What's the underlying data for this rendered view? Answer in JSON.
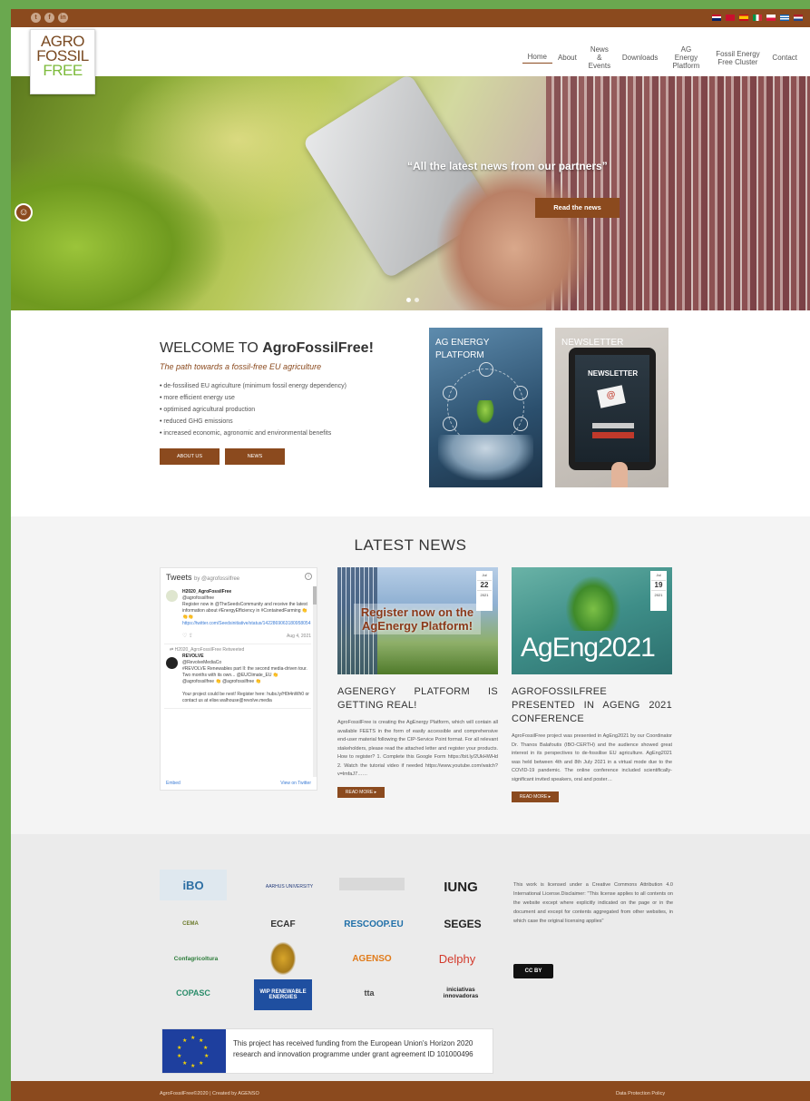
{
  "colors": {
    "brand_brown": "#8b4a1e",
    "brand_green": "#7dbb3b",
    "frame_green": "#6aa84f"
  },
  "logo": {
    "line1": "AGRO",
    "line2": "FOSSIL",
    "line3": "FREE"
  },
  "nav": {
    "home": "Home",
    "about": "About",
    "news_events": "News & Events",
    "downloads": "Downloads",
    "ag_energy_platform": "AG Energy Platform",
    "fossil_energy_free_cluster": "Fossil Energy Free Cluster",
    "contact": "Contact"
  },
  "hero": {
    "caption": "“All the latest news from our partners”",
    "button": "Read the news"
  },
  "welcome": {
    "title_prefix": "WELCOME TO ",
    "title_brand": "AgroFossilFree!",
    "tagline": "The path towards a fossil-free EU agriculture",
    "bullets": [
      "de-fossilised EU agriculture (minimum fossil energy dependency)",
      "more efficient energy use",
      "optimised agricultural production",
      "reduced GHG emissions",
      "increased economic, agronomic and environmental benefits"
    ],
    "btn_about": "ABOUT US",
    "btn_news": "NEWS"
  },
  "cards": {
    "ag_energy": "AG ENERGY PLATFORM",
    "newsletter": "NEWSLETTER",
    "newsletter_screen": "NEWSLETTER",
    "subscribe": "SUBSCRIBE"
  },
  "latest_news": {
    "heading": "LATEST NEWS",
    "tweets": {
      "title": "Tweets",
      "by": "by @agrofossilfree",
      "tweet1_name": "H2020_AgroFossilFree",
      "tweet1_handle": "@agrofossilfree",
      "tweet1_text": "Register now in @TheSeedsCommunity and receive the latest information about #EnergyEfficiency in #ContainedFarming 👏👏👏",
      "tweet1_link": "https://twitter.com/Seedsinitiative/status/1422869063180958054",
      "tweet1_date": "Aug 4, 2021",
      "retweet_label": "H2020_AgroFossilFree Retweeted",
      "tweet2_name": "REVOLVE",
      "tweet2_handle": "@RevolveMediaCo",
      "tweet2_text": "#REVOLVE Renewables part II: the second media-driven tour. Two months with its own... @EUClimate_EU 👏 @agrofossilfree 👏 @agrofossilfree 👏",
      "tweet2_more": "Your project could be next! Register here: hubs.ly/H0t4nWh0 or contact us at elise.walhouse@revolve.media",
      "embed": "Embed",
      "view_on": "View on Twitter"
    },
    "posts": [
      {
        "month": "Jul",
        "day": "22",
        "year": "2021",
        "image_text": "Register now on the AgEnergy Platform!",
        "title": "AGENERGY PLATFORM IS GETTING REAL!",
        "excerpt": "AgroFossilFree is creating the AgEnergy Platform, which will contain all available FEETS in the form of easily accessible and comprehensive end-user material following the CIP-Service Point format. For all relevant stakeholders, please read the attached letter and register your products. How to register? 1. Complete this Google Form https://bit.ly/2UkHWHd 2. Watch the tutorial video if needed https://www.youtube.com/watch?v=lmfaJ7……",
        "read_more": "READ MORE ▸"
      },
      {
        "month": "Jul",
        "day": "19",
        "year": "2021",
        "image_text": "AgEng2021",
        "title": "AGROFOSSILFREE PRESENTED IN AGENG 2021 CONFERENCE",
        "excerpt": "AgroFossilFree project was presented in AgEng2021 by our Coordinator Dr. Thanos Balafoutis (IBO-CERTH) and the audience showed great interest in its perspectives to de-fossilise EU agriculture. AgEng2021 was held between 4th and 8th July 2021 in a virtual mode due to the COVID-19 pandemic. The online conference included scientifically-significant invited speakers, oral and poster…",
        "read_more": "READ MORE ▸"
      }
    ]
  },
  "partners": {
    "logos": [
      "iBO",
      "AARHUS UNIVERSITY",
      "",
      "IUNG",
      "CEMA",
      "ECAF",
      "RESCOOP.EU",
      "SEGES",
      "Confagricoltura",
      "",
      "AGENSO",
      "Delphy",
      "COPASC",
      "WIP RENEWABLE ENERGIES",
      "tta",
      "iniciativas innovadoras"
    ],
    "license": "This work is licensed under a Creative Commons Attribution 4.0 International License.Disclaimer: \"This license applies to all contents on the website except where explicitly indicated on the page or in the document and except for contents aggregated from other websites, in which case the original licensing applies\"",
    "cc_badge": "CC BY",
    "eu_text": "This project has received funding from the European Union's Horizon 2020 research and innovation programme under grant agreement ID 101000496"
  },
  "footer": {
    "left": "AgroFossilFree©2020 | Created by AGENSO",
    "right": "Data Protection Policy"
  }
}
